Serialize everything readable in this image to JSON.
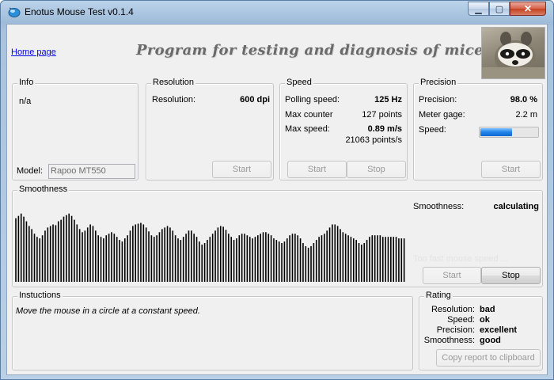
{
  "window": {
    "title": "Enotus Mouse Test v0.1.4",
    "close_glyph": "✕",
    "min_glyph": "▁",
    "max_glyph": "▢"
  },
  "header": {
    "home_link": "Home page",
    "headline": "Program for testing and diagnosis of mice",
    "logo_icon": "raccoon-photo"
  },
  "info": {
    "legend": "Info",
    "status": "n/a",
    "model_label": "Model:",
    "model_value": "Rapoo MT550"
  },
  "resolution": {
    "legend": "Resolution",
    "label": "Resolution:",
    "value": "600 dpi",
    "start": "Start"
  },
  "speed": {
    "legend": "Speed",
    "polling_label": "Polling speed:",
    "polling_value": "125 Hz",
    "counter_label": "Max counter",
    "counter_value": "127 points",
    "max_speed_label": "Max  speed:",
    "max_speed_value": "0.89 m/s",
    "max_speed_points": "21063 points/s",
    "start": "Start",
    "stop": "Stop"
  },
  "precision": {
    "legend": "Precision",
    "precision_label": "Precision:",
    "precision_value": "98.0 %",
    "gage_label": "Meter gage:",
    "gage_value": "2.2 m",
    "speed_label": "Speed:",
    "speed_level": 0.55,
    "start": "Start"
  },
  "smoothness": {
    "legend": "Smoothness",
    "label": "Smoothness:",
    "value": "calculating",
    "warning": "Too fast mouse speed ...",
    "start": "Start",
    "stop": "Stop",
    "wave": [
      0.82,
      0.85,
      0.88,
      0.84,
      0.78,
      0.72,
      0.68,
      0.62,
      0.58,
      0.56,
      0.6,
      0.66,
      0.7,
      0.72,
      0.74,
      0.73,
      0.78,
      0.8,
      0.84,
      0.86,
      0.88,
      0.85,
      0.8,
      0.74,
      0.68,
      0.64,
      0.66,
      0.7,
      0.74,
      0.72,
      0.66,
      0.6,
      0.58,
      0.56,
      0.6,
      0.62,
      0.64,
      0.62,
      0.58,
      0.54,
      0.52,
      0.56,
      0.6,
      0.66,
      0.72,
      0.74,
      0.75,
      0.76,
      0.74,
      0.7,
      0.65,
      0.6,
      0.58,
      0.6,
      0.64,
      0.68,
      0.7,
      0.72,
      0.7,
      0.66,
      0.6,
      0.56,
      0.54,
      0.58,
      0.62,
      0.66,
      0.66,
      0.62,
      0.58,
      0.52,
      0.48,
      0.5,
      0.54,
      0.58,
      0.62,
      0.66,
      0.7,
      0.72,
      0.71,
      0.67,
      0.62,
      0.58,
      0.54,
      0.56,
      0.6,
      0.62,
      0.62,
      0.6,
      0.58,
      0.56,
      0.58,
      0.6,
      0.62,
      0.64,
      0.64,
      0.62,
      0.6,
      0.56,
      0.54,
      0.52,
      0.5,
      0.52,
      0.56,
      0.6,
      0.62,
      0.62,
      0.6,
      0.56,
      0.5,
      0.46,
      0.44,
      0.46,
      0.5,
      0.54,
      0.58,
      0.6,
      0.62,
      0.66,
      0.7,
      0.74,
      0.74,
      0.72,
      0.68,
      0.64,
      0.62,
      0.6,
      0.58,
      0.56,
      0.54,
      0.5,
      0.48,
      0.5,
      0.54,
      0.58,
      0.6,
      0.6,
      0.6,
      0.6,
      0.58,
      0.58,
      0.58,
      0.58,
      0.58,
      0.58,
      0.56,
      0.56,
      0.56
    ]
  },
  "instructions": {
    "legend": "Instuctions",
    "text": "Move the mouse in a circle at a constant speed."
  },
  "rating": {
    "legend": "Rating",
    "rows": [
      {
        "label": "Resolution:",
        "value": "bad"
      },
      {
        "label": "Speed:",
        "value": "ok"
      },
      {
        "label": "Precision:",
        "value": "excellent"
      },
      {
        "label": "Smoothness:",
        "value": "good"
      }
    ],
    "copy_button": "Copy report to clipboard"
  }
}
